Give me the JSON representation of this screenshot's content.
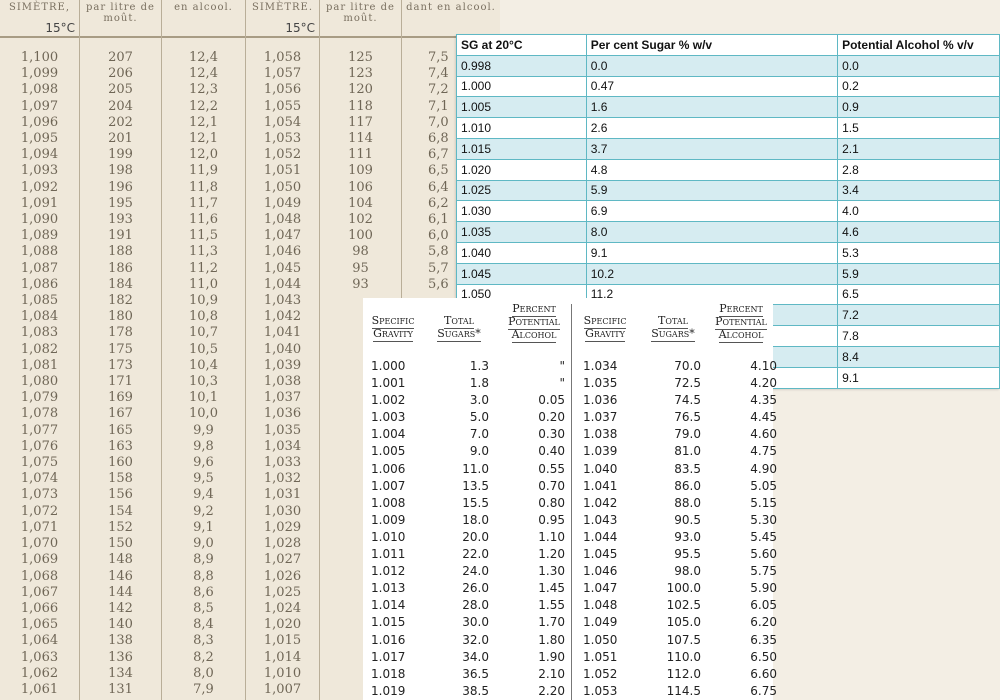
{
  "old_table": {
    "headers": [
      {
        "title": "SIMÈTRE,",
        "temp": "15°C"
      },
      {
        "title": "par litre de moût.",
        "temp": ""
      },
      {
        "title": "en alcool.",
        "temp": ""
      },
      {
        "title": "SIMÈTRE.",
        "temp": "15°C"
      },
      {
        "title": "par litre de moût.",
        "temp": ""
      },
      {
        "title": "dant en alcool.",
        "temp": ""
      }
    ],
    "left_density": [
      "1,100",
      "1,099",
      "1,098",
      "1,097",
      "1,096",
      "1,095",
      "1,094",
      "1,093",
      "1,092",
      "1,091",
      "1,090",
      "1,089",
      "1,088",
      "1,087",
      "1,086",
      "1,085",
      "1,084",
      "1,083",
      "1,082",
      "1,081",
      "1,080",
      "1,079",
      "1,078",
      "1,077",
      "1,076",
      "1,075",
      "1,074",
      "1,073",
      "1,072",
      "1,071",
      "1,070",
      "1,069",
      "1,068",
      "1,067",
      "1,066",
      "1,065",
      "1,064",
      "1,063",
      "1,062",
      "1,061"
    ],
    "left_sugar": [
      "207",
      "206",
      "205",
      "204",
      "202",
      "201",
      "199",
      "198",
      "196",
      "195",
      "193",
      "191",
      "188",
      "186",
      "184",
      "182",
      "180",
      "178",
      "175",
      "173",
      "171",
      "169",
      "167",
      "165",
      "163",
      "160",
      "158",
      "156",
      "154",
      "152",
      "150",
      "148",
      "146",
      "144",
      "142",
      "140",
      "138",
      "136",
      "134",
      "131"
    ],
    "left_alcohol": [
      "12,4",
      "12,4",
      "12,3",
      "12,2",
      "12,1",
      "12,1",
      "12,0",
      "11,9",
      "11,8",
      "11,7",
      "11,6",
      "11,5",
      "11,3",
      "11,2",
      "11,0",
      "10,9",
      "10,8",
      "10,7",
      "10,5",
      "10,4",
      "10,3",
      "10,1",
      "10,0",
      "9,9",
      "9,8",
      "9,6",
      "9,5",
      "9,4",
      "9,2",
      "9,1",
      "9,0",
      "8,9",
      "8,8",
      "8,6",
      "8,5",
      "8,4",
      "8,3",
      "8,2",
      "8,0",
      "7,9"
    ],
    "right_density": [
      "1,058",
      "1,057",
      "1,056",
      "1,055",
      "1,054",
      "1,053",
      "1,052",
      "1,051",
      "1,050",
      "1,049",
      "1,048",
      "1,047",
      "1,046",
      "1,045",
      "1,044",
      "1,043",
      "1,042",
      "1,041",
      "1,040",
      "1,039",
      "1,038",
      "1,037",
      "1,036",
      "1,035",
      "1,034",
      "1,033",
      "1,032",
      "1,031",
      "1,030",
      "1,029",
      "1,028",
      "1,027",
      "1,026",
      "1,025",
      "1,024",
      "1,020",
      "1,015",
      "1,014",
      "1,010",
      "1,007"
    ],
    "right_sugar": [
      "125",
      "123",
      "120",
      "118",
      "117",
      "114",
      "111",
      "109",
      "106",
      "104",
      "102",
      "100",
      "98",
      "95",
      "93"
    ],
    "right_alcohol": [
      "7,5",
      "7,4",
      "7,2",
      "7,1",
      "7,0",
      "6,8",
      "6,7",
      "6,5",
      "6,4",
      "6,2",
      "6,1",
      "6,0",
      "5,8",
      "5,7",
      "5,6"
    ]
  },
  "sg_table": {
    "headers": [
      "SG at 20°C",
      "Per cent Sugar % w/v",
      "Potential Alcohol % v/v"
    ],
    "rows": [
      [
        "0.998",
        "0.0",
        "0.0"
      ],
      [
        "1.000",
        "0.47",
        "0.2"
      ],
      [
        "1.005",
        "1.6",
        "0.9"
      ],
      [
        "1.010",
        "2.6",
        "1.5"
      ],
      [
        "1.015",
        "3.7",
        "2.1"
      ],
      [
        "1.020",
        "4.8",
        "2.8"
      ],
      [
        "1.025",
        "5.9",
        "3.4"
      ],
      [
        "1.030",
        "6.9",
        "4.0"
      ],
      [
        "1.035",
        "8.0",
        "4.6"
      ],
      [
        "1.040",
        "9.1",
        "5.3"
      ],
      [
        "1.045",
        "10.2",
        "5.9"
      ],
      [
        "1.050",
        "11.2",
        "6.5"
      ],
      [
        "",
        "",
        "7.2"
      ],
      [
        "",
        "",
        "7.8"
      ],
      [
        "",
        "",
        "8.4"
      ],
      [
        "",
        "",
        "9.1"
      ]
    ]
  },
  "specific_gravity_table": {
    "headers": [
      "Specific Gravity",
      "Total Sugars*",
      "Percent Potential Alcohol",
      "Specific Gravity",
      "Total Sugars*",
      "Percent Potential Alcohol"
    ],
    "left_rows": [
      [
        "1.000",
        "1.3",
        "\""
      ],
      [
        "1.001",
        "1.8",
        "\""
      ],
      [
        "1.002",
        "3.0",
        "0.05"
      ],
      [
        "1.003",
        "5.0",
        "0.20"
      ],
      [
        "1.004",
        "7.0",
        "0.30"
      ],
      [
        "1.005",
        "9.0",
        "0.40"
      ],
      [
        "1.006",
        "11.0",
        "0.55"
      ],
      [
        "1.007",
        "13.5",
        "0.70"
      ],
      [
        "1.008",
        "15.5",
        "0.80"
      ],
      [
        "1.009",
        "18.0",
        "0.95"
      ],
      [
        "1.010",
        "20.0",
        "1.10"
      ],
      [
        "1.011",
        "22.0",
        "1.20"
      ],
      [
        "1.012",
        "24.0",
        "1.30"
      ],
      [
        "1.013",
        "26.0",
        "1.45"
      ],
      [
        "1.014",
        "28.0",
        "1.55"
      ],
      [
        "1.015",
        "30.0",
        "1.70"
      ],
      [
        "1.016",
        "32.0",
        "1.80"
      ],
      [
        "1.017",
        "34.0",
        "1.90"
      ],
      [
        "1.018",
        "36.5",
        "2.10"
      ],
      [
        "1.019",
        "38.5",
        "2.20"
      ]
    ],
    "right_rows": [
      [
        "1.034",
        "70.0",
        "4.10"
      ],
      [
        "1.035",
        "72.5",
        "4.20"
      ],
      [
        "1.036",
        "74.5",
        "4.35"
      ],
      [
        "1.037",
        "76.5",
        "4.45"
      ],
      [
        "1.038",
        "79.0",
        "4.60"
      ],
      [
        "1.039",
        "81.0",
        "4.75"
      ],
      [
        "1.040",
        "83.5",
        "4.90"
      ],
      [
        "1.041",
        "86.0",
        "5.05"
      ],
      [
        "1.042",
        "88.0",
        "5.15"
      ],
      [
        "1.043",
        "90.5",
        "5.30"
      ],
      [
        "1.044",
        "93.0",
        "5.45"
      ],
      [
        "1.045",
        "95.5",
        "5.60"
      ],
      [
        "1.046",
        "98.0",
        "5.75"
      ],
      [
        "1.047",
        "100.0",
        "5.90"
      ],
      [
        "1.048",
        "102.5",
        "6.05"
      ],
      [
        "1.049",
        "105.0",
        "6.20"
      ],
      [
        "1.050",
        "107.5",
        "6.35"
      ],
      [
        "1.051",
        "110.0",
        "6.50"
      ],
      [
        "1.052",
        "112.0",
        "6.60"
      ],
      [
        "1.053",
        "114.5",
        "6.75"
      ]
    ]
  }
}
